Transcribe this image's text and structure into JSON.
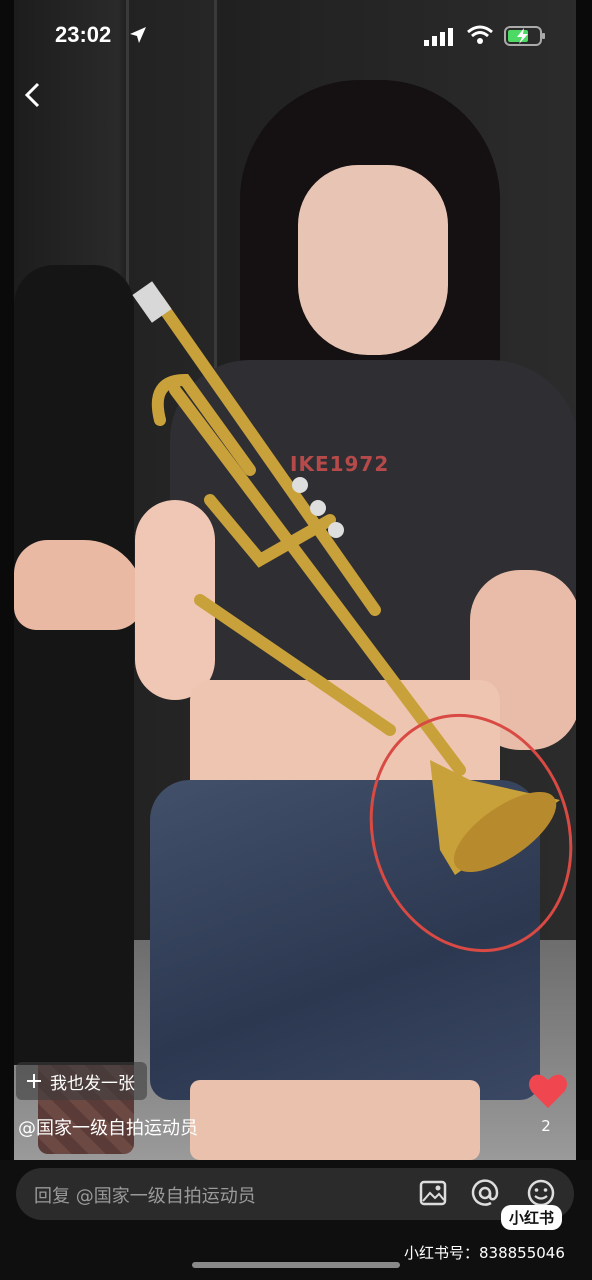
{
  "status_bar": {
    "time": "23:02"
  },
  "overlay": {
    "post_button_label": "我也发一张",
    "author": "@国家一级自拍运动员",
    "like_count": "2",
    "shirt_print": "IKE1972"
  },
  "reply_bar": {
    "placeholder": "回复 @国家一级自拍运动员"
  },
  "watermark": {
    "badge": "小红书",
    "id_text": "小红书号：838855046"
  },
  "colors": {
    "accent_heart": "#f0464f",
    "annotation_circle": "#d84a43"
  }
}
